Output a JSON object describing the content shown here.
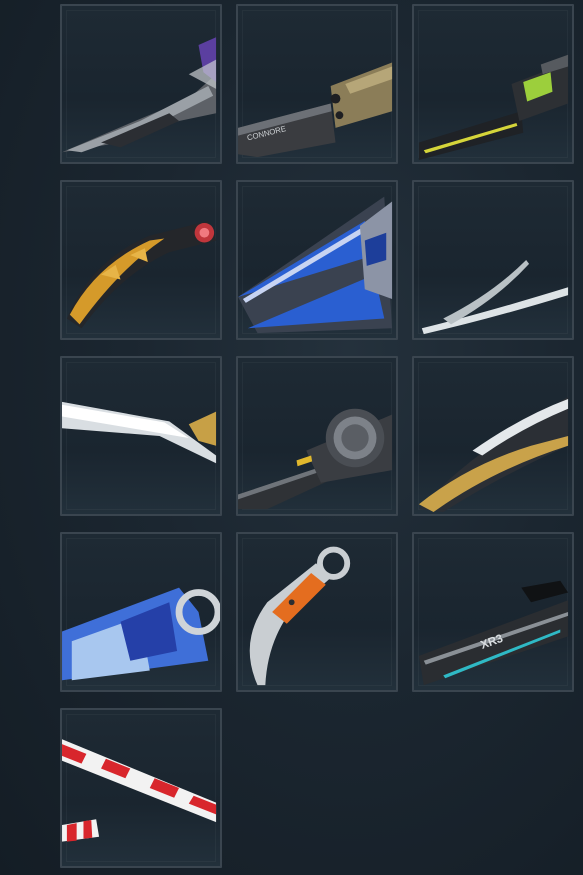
{
  "collection": {
    "skins": [
      {
        "icon": "reaver-knife-icon",
        "accent": "#7b7f86"
      },
      {
        "icon": "combat-knife-icon",
        "accent": "#9b8c66",
        "engraving": "CONNORE"
      },
      {
        "icon": "tech-blade-icon",
        "accent": "#9ccf3c"
      },
      {
        "icon": "karambit-gold-icon",
        "accent": "#d59a2a"
      },
      {
        "icon": "blue-crystal-blade-icon",
        "accent": "#2a5fd1"
      },
      {
        "icon": "curved-claw-icon",
        "accent": "#c9d0d2"
      },
      {
        "icon": "silver-sword-icon",
        "accent": "#e7ecef"
      },
      {
        "icon": "ring-dagger-icon",
        "accent": "#3a3d42"
      },
      {
        "icon": "gold-edge-blade-icon",
        "accent": "#c9a24a"
      },
      {
        "icon": "comic-kunai-icon",
        "accent": "#3f6fd8"
      },
      {
        "icon": "orange-karambit-icon",
        "accent": "#e46d1f"
      },
      {
        "icon": "cyber-blade-icon",
        "accent": "#2fb9c5",
        "engraving": "XR3"
      },
      {
        "icon": "candy-cane-icon",
        "accent": "#d8262c"
      }
    ]
  }
}
